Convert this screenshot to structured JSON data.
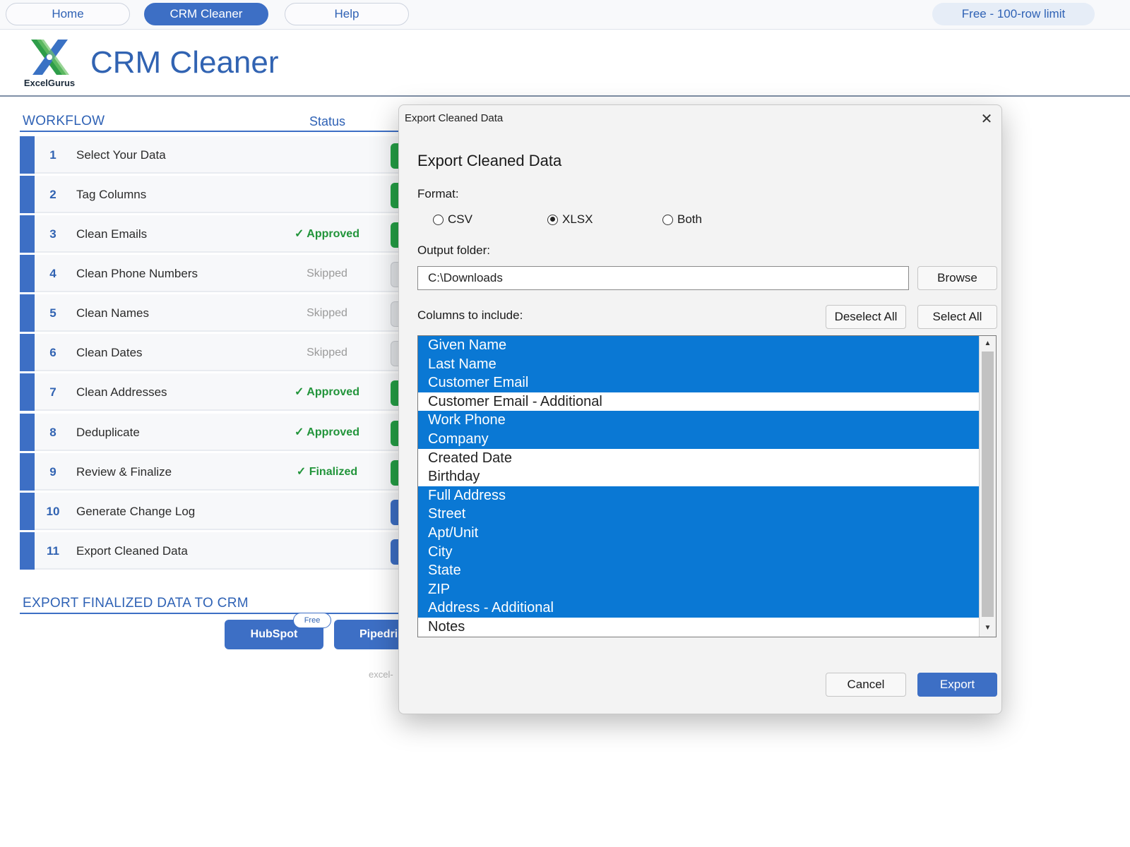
{
  "nav": {
    "tabs": [
      {
        "label": "Home",
        "active": false
      },
      {
        "label": "CRM Cleaner",
        "active": true
      },
      {
        "label": "Help",
        "active": false
      }
    ],
    "plan_badge": "Free - 100-row limit"
  },
  "header": {
    "logo_text": "ExcelGurus",
    "title": "CRM Cleaner"
  },
  "workflow": {
    "title": "WORKFLOW",
    "status_header": "Status",
    "steps": [
      {
        "num": "1",
        "label": "Select Your Data",
        "status": ""
      },
      {
        "num": "2",
        "label": "Tag Columns",
        "status": ""
      },
      {
        "num": "3",
        "label": "Clean Emails",
        "status": "✓ Approved"
      },
      {
        "num": "4",
        "label": "Clean Phone Numbers",
        "status": "Skipped"
      },
      {
        "num": "5",
        "label": "Clean Names",
        "status": "Skipped"
      },
      {
        "num": "6",
        "label": "Clean Dates",
        "status": "Skipped"
      },
      {
        "num": "7",
        "label": "Clean Addresses",
        "status": "✓ Approved"
      },
      {
        "num": "8",
        "label": "Deduplicate",
        "status": "✓ Approved"
      },
      {
        "num": "9",
        "label": "Review & Finalize",
        "status": "✓ Finalized"
      },
      {
        "num": "10",
        "label": "Generate Change Log",
        "status": ""
      },
      {
        "num": "11",
        "label": "Export Cleaned Data",
        "status": ""
      }
    ]
  },
  "export_crm": {
    "title": "EXPORT FINALIZED DATA TO CRM",
    "buttons": [
      "HubSpot",
      "Pipedri"
    ],
    "free_tag": "Free",
    "footer_partial": "excel-"
  },
  "dialog": {
    "window_title": "Export Cleaned Data",
    "heading": "Export Cleaned Data",
    "format_label": "Format:",
    "format_options": [
      "CSV",
      "XLSX",
      "Both"
    ],
    "format_selected": "XLSX",
    "output_folder_label": "Output folder:",
    "output_folder_value": "C:\\Downloads",
    "browse_label": "Browse",
    "columns_label": "Columns to include:",
    "deselect_all_label": "Deselect All",
    "select_all_label": "Select All",
    "columns": [
      {
        "name": "Given Name",
        "selected": true
      },
      {
        "name": "Last Name",
        "selected": true
      },
      {
        "name": "Customer Email",
        "selected": true
      },
      {
        "name": "Customer Email - Additional",
        "selected": false
      },
      {
        "name": "Work Phone",
        "selected": true
      },
      {
        "name": "Company",
        "selected": true
      },
      {
        "name": "Created Date",
        "selected": false
      },
      {
        "name": "Birthday",
        "selected": false
      },
      {
        "name": "Full Address",
        "selected": true
      },
      {
        "name": "Street",
        "selected": true
      },
      {
        "name": "Apt/Unit",
        "selected": true
      },
      {
        "name": "City",
        "selected": true
      },
      {
        "name": "State",
        "selected": true
      },
      {
        "name": "ZIP",
        "selected": true
      },
      {
        "name": "Address - Additional",
        "selected": true
      },
      {
        "name": "Notes",
        "selected": false
      }
    ],
    "cancel_label": "Cancel",
    "export_label": "Export"
  },
  "colors": {
    "brand_blue": "#3d6fc5",
    "approved_green": "#21943a",
    "selection_blue": "#0a78d4"
  }
}
